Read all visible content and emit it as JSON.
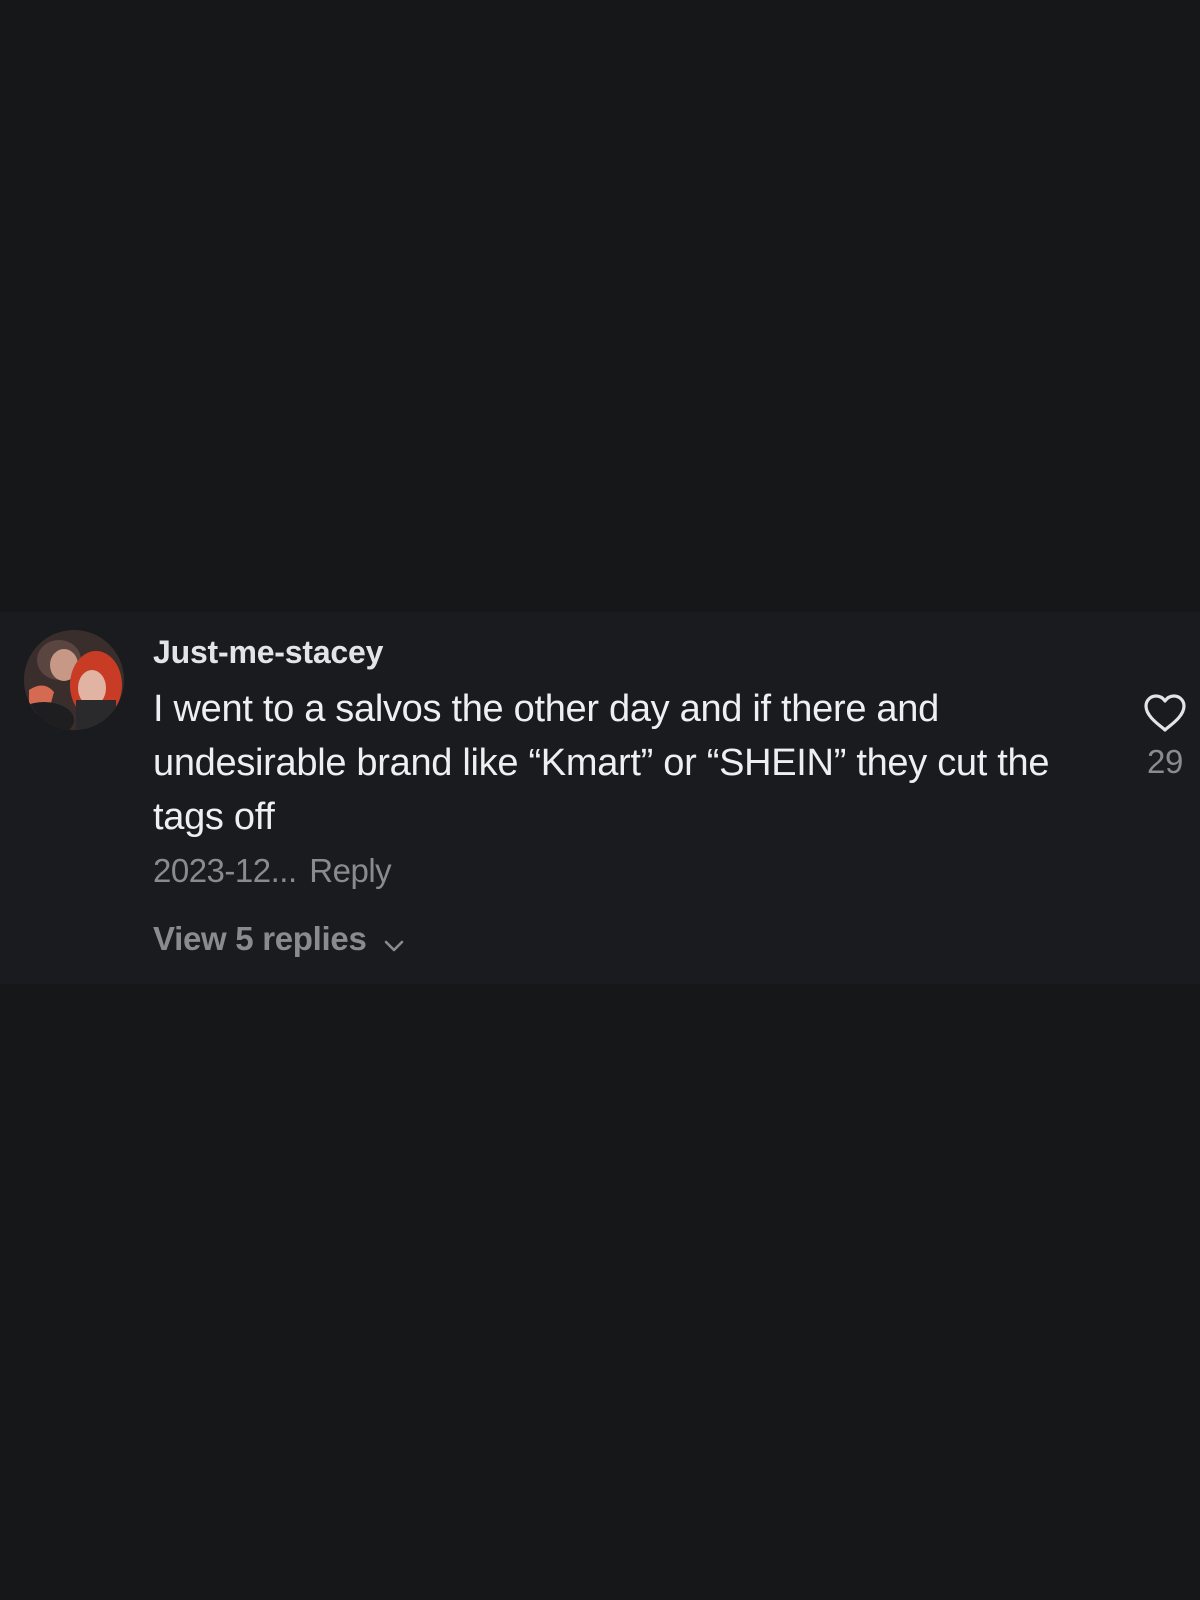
{
  "comment": {
    "username": "Just-me-stacey",
    "text": "I went to a salvos the other day and if there and undesirable brand like “Kmart” or “SHEIN” they cut the tags off",
    "date": "2023-12...",
    "reply_label": "Reply",
    "view_replies_label": "View 5 replies",
    "like_count": "29"
  },
  "colors": {
    "background": "#161719",
    "comment_background": "#1a1b1e",
    "text_primary": "#efeff1",
    "text_secondary": "#8a8b8e"
  },
  "icons": {
    "like": "heart-outline-icon",
    "expand": "chevron-down-icon"
  }
}
